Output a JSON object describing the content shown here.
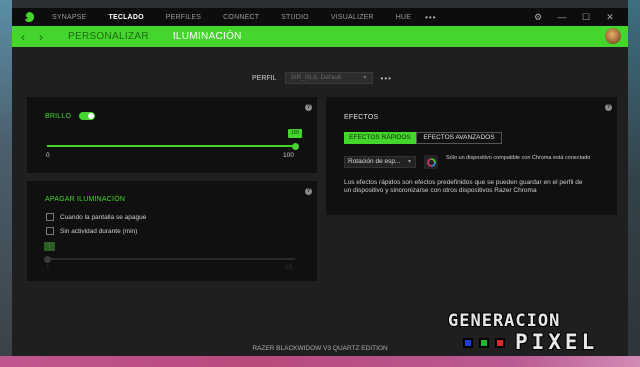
{
  "window": {
    "nav_tabs": [
      "SYNAPSE",
      "TECLADO",
      "PERFILES",
      "CONNECT",
      "STUDIO",
      "VISUALIZER",
      "HUE"
    ],
    "active_nav_tab": "TECLADO",
    "nav_more": "•••",
    "controls": {
      "settings": "⚙",
      "minimize": "—",
      "maximize": "☐",
      "close": "✕"
    }
  },
  "subnav": {
    "back": "‹",
    "forward": "›",
    "tabs": [
      "PERSONALIZAR",
      "ILUMINACIÓN"
    ],
    "active_tab": "ILUMINACIÓN"
  },
  "profile": {
    "label": "PERFIL",
    "value": "SIR_RL8, Default",
    "more": "•••"
  },
  "brightness": {
    "title": "BRILLO",
    "enabled": true,
    "value": "100",
    "min_label": "0",
    "max_label": "100",
    "level": 1.0
  },
  "power_off": {
    "title": "APAGAR ILUMINACIÓN",
    "option1": "Cuando la pantalla se apague",
    "option2": "Sin actividad durante (min)",
    "option1_checked": false,
    "option2_checked": false,
    "slider_value": "1",
    "min_label": "1",
    "max_label": "15"
  },
  "effects": {
    "title": "EFECTOS",
    "tab_quick": "EFECTOS RÁPIDOS",
    "tab_advanced": "EFECTOS AVANZADOS",
    "active_tab": "EFECTOS RÁPIDOS",
    "selected_effect": "Rotación de esp...",
    "chroma_note": "Sólo un dispositivo compatible con Chroma está conectado",
    "description": "Los efectos rápidos son efectos predefinidos que se pueden guardar en el perfil de un dispositivo y sincronizarse con otros dispositivos Razer Chroma"
  },
  "info_icon": "?",
  "footer": {
    "device": "RAZER BLACKWIDOW V3 QUARTZ EDITION"
  },
  "watermark": {
    "line1": "GENERACION",
    "line2": "PIXEL",
    "squares": [
      "#1f3fd9",
      "#22b52e",
      "#d92b2b"
    ]
  },
  "colors": {
    "accent": "#44d62c",
    "panel": "#101010",
    "background": "#1f1f1f"
  }
}
